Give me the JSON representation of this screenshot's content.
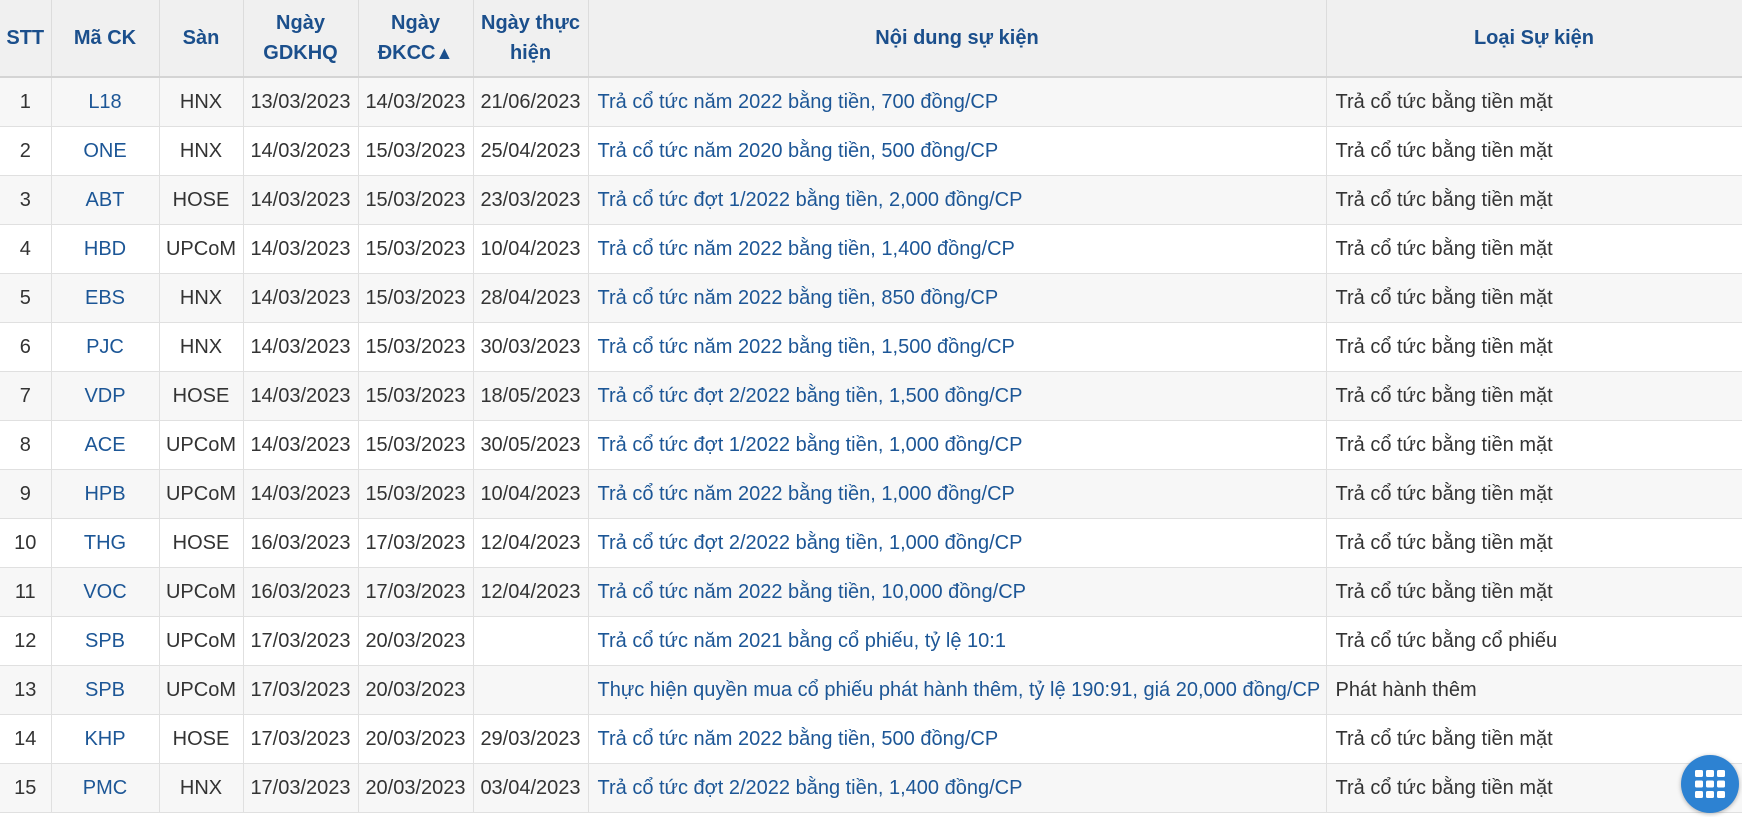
{
  "columns": {
    "stt": "STT",
    "ma_ck": "Mã CK",
    "san": "Sàn",
    "gdkhq_line1": "Ngày",
    "gdkhq_line2": "GDKHQ",
    "dkcc_line1": "Ngày",
    "dkcc_line2": "ĐKCC",
    "dkcc_sort_indicator": "▲",
    "thuc_hien_line1": "Ngày thực",
    "thuc_hien_line2": "hiện",
    "noi_dung": "Nội dung sự kiện",
    "loai": "Loại Sự kiện"
  },
  "rows": [
    {
      "stt": "1",
      "ma_ck": "L18",
      "san": "HNX",
      "gdkhq": "13/03/2023",
      "dkcc": "14/03/2023",
      "thuc_hien": "21/06/2023",
      "noi_dung": "Trả cổ tức năm 2022 bằng tiền, 700 đồng/CP",
      "loai": "Trả cổ tức bằng tiền mặt"
    },
    {
      "stt": "2",
      "ma_ck": "ONE",
      "san": "HNX",
      "gdkhq": "14/03/2023",
      "dkcc": "15/03/2023",
      "thuc_hien": "25/04/2023",
      "noi_dung": "Trả cổ tức năm 2020 bằng tiền, 500 đồng/CP",
      "loai": "Trả cổ tức bằng tiền mặt"
    },
    {
      "stt": "3",
      "ma_ck": "ABT",
      "san": "HOSE",
      "gdkhq": "14/03/2023",
      "dkcc": "15/03/2023",
      "thuc_hien": "23/03/2023",
      "noi_dung": "Trả cổ tức đợt 1/2022 bằng tiền, 2,000 đồng/CP",
      "loai": "Trả cổ tức bằng tiền mặt"
    },
    {
      "stt": "4",
      "ma_ck": "HBD",
      "san": "UPCoM",
      "gdkhq": "14/03/2023",
      "dkcc": "15/03/2023",
      "thuc_hien": "10/04/2023",
      "noi_dung": "Trả cổ tức năm 2022 bằng tiền, 1,400 đồng/CP",
      "loai": "Trả cổ tức bằng tiền mặt"
    },
    {
      "stt": "5",
      "ma_ck": "EBS",
      "san": "HNX",
      "gdkhq": "14/03/2023",
      "dkcc": "15/03/2023",
      "thuc_hien": "28/04/2023",
      "noi_dung": "Trả cổ tức năm 2022 bằng tiền, 850 đồng/CP",
      "loai": "Trả cổ tức bằng tiền mặt"
    },
    {
      "stt": "6",
      "ma_ck": "PJC",
      "san": "HNX",
      "gdkhq": "14/03/2023",
      "dkcc": "15/03/2023",
      "thuc_hien": "30/03/2023",
      "noi_dung": "Trả cổ tức năm 2022 bằng tiền, 1,500 đồng/CP",
      "loai": "Trả cổ tức bằng tiền mặt"
    },
    {
      "stt": "7",
      "ma_ck": "VDP",
      "san": "HOSE",
      "gdkhq": "14/03/2023",
      "dkcc": "15/03/2023",
      "thuc_hien": "18/05/2023",
      "noi_dung": "Trả cổ tức đợt 2/2022 bằng tiền, 1,500 đồng/CP",
      "loai": "Trả cổ tức bằng tiền mặt"
    },
    {
      "stt": "8",
      "ma_ck": "ACE",
      "san": "UPCoM",
      "gdkhq": "14/03/2023",
      "dkcc": "15/03/2023",
      "thuc_hien": "30/05/2023",
      "noi_dung": "Trả cổ tức đợt 1/2022 bằng tiền, 1,000 đồng/CP",
      "loai": "Trả cổ tức bằng tiền mặt"
    },
    {
      "stt": "9",
      "ma_ck": "HPB",
      "san": "UPCoM",
      "gdkhq": "14/03/2023",
      "dkcc": "15/03/2023",
      "thuc_hien": "10/04/2023",
      "noi_dung": "Trả cổ tức năm 2022 bằng tiền, 1,000 đồng/CP",
      "loai": "Trả cổ tức bằng tiền mặt"
    },
    {
      "stt": "10",
      "ma_ck": "THG",
      "san": "HOSE",
      "gdkhq": "16/03/2023",
      "dkcc": "17/03/2023",
      "thuc_hien": "12/04/2023",
      "noi_dung": "Trả cổ tức đợt 2/2022 bằng tiền, 1,000 đồng/CP",
      "loai": "Trả cổ tức bằng tiền mặt"
    },
    {
      "stt": "11",
      "ma_ck": "VOC",
      "san": "UPCoM",
      "gdkhq": "16/03/2023",
      "dkcc": "17/03/2023",
      "thuc_hien": "12/04/2023",
      "noi_dung": "Trả cổ tức năm 2022 bằng tiền, 10,000 đồng/CP",
      "loai": "Trả cổ tức bằng tiền mặt"
    },
    {
      "stt": "12",
      "ma_ck": "SPB",
      "san": "UPCoM",
      "gdkhq": "17/03/2023",
      "dkcc": "20/03/2023",
      "thuc_hien": "",
      "noi_dung": "Trả cổ tức năm 2021 bằng cổ phiếu, tỷ lệ 10:1",
      "loai": "Trả cổ tức bằng cổ phiếu"
    },
    {
      "stt": "13",
      "ma_ck": "SPB",
      "san": "UPCoM",
      "gdkhq": "17/03/2023",
      "dkcc": "20/03/2023",
      "thuc_hien": "",
      "noi_dung": "Thực hiện quyền mua cổ phiếu phát hành thêm, tỷ lệ 190:91, giá 20,000 đồng/CP",
      "loai": "Phát hành thêm"
    },
    {
      "stt": "14",
      "ma_ck": "KHP",
      "san": "HOSE",
      "gdkhq": "17/03/2023",
      "dkcc": "20/03/2023",
      "thuc_hien": "29/03/2023",
      "noi_dung": "Trả cổ tức năm 2022 bằng tiền, 500 đồng/CP",
      "loai": "Trả cổ tức bằng tiền mặt"
    },
    {
      "stt": "15",
      "ma_ck": "PMC",
      "san": "HNX",
      "gdkhq": "17/03/2023",
      "dkcc": "20/03/2023",
      "thuc_hien": "03/04/2023",
      "noi_dung": "Trả cổ tức đợt 2/2022 bằng tiền, 1,400 đồng/CP",
      "loai": "Trả cổ tức bằng tiền mặt"
    }
  ],
  "fab": {
    "icon": "grid-menu-icon",
    "color": "#2d82d2"
  },
  "colors": {
    "header_bg": "#f0f0f0",
    "header_text": "#1b4f8c",
    "link": "#1c5696",
    "even_row_bg": "#f7f7f7",
    "text": "#333333"
  }
}
